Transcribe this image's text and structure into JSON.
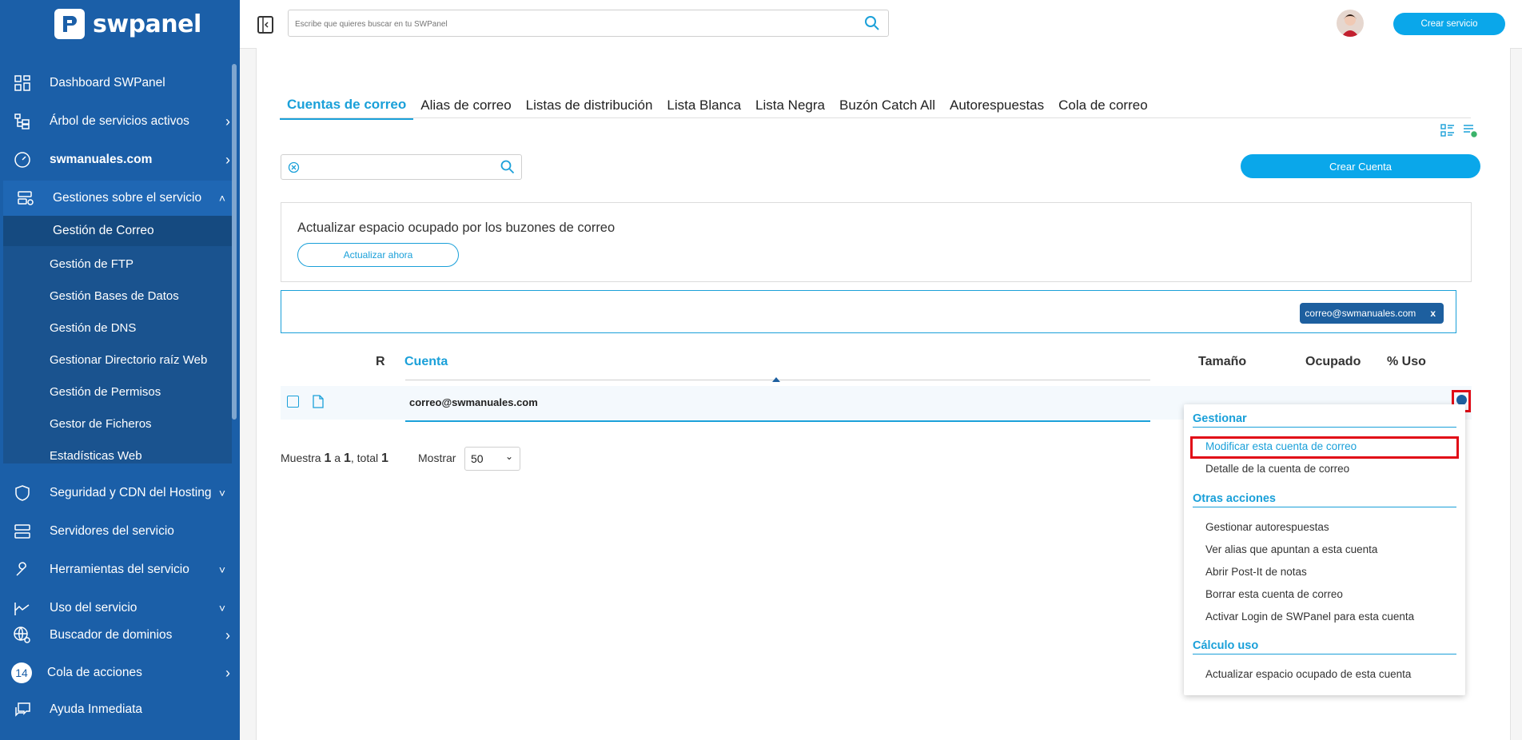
{
  "app": {
    "brand": "swpanel"
  },
  "sidebar": {
    "items": [
      {
        "label": "Dashboard SWPanel",
        "icon": "dashboard-icon"
      },
      {
        "label": "Árbol de servicios activos",
        "icon": "tree-icon"
      },
      {
        "label": "swmanuales.com",
        "icon": "speedometer-icon"
      },
      {
        "label": "Gestiones sobre el servicio",
        "icon": "server-settings-icon"
      },
      {
        "label": "Seguridad y CDN del Hosting",
        "icon": "shield-icon"
      },
      {
        "label": "Servidores del servicio",
        "icon": "servers-icon"
      },
      {
        "label": "Herramientas del servicio",
        "icon": "wrench-icon"
      },
      {
        "label": "Uso del servicio",
        "icon": "chart-icon"
      },
      {
        "label": "Buscador de dominios",
        "icon": "globe-search-icon"
      },
      {
        "label": "Cola de acciones",
        "badge": "14"
      },
      {
        "label": "Ayuda Inmediata",
        "icon": "chat-icon"
      }
    ],
    "subitems": [
      "Gestión de Correo",
      "Gestión de FTP",
      "Gestión Bases de Datos",
      "Gestión de DNS",
      "Gestionar Directorio raíz Web",
      "Gestión de Permisos",
      "Gestor de Ficheros",
      "Estadísticas Web"
    ]
  },
  "topbar": {
    "search_placeholder": "Escribe que quieres buscar en tu SWPanel",
    "create_service": "Crear servicio"
  },
  "tabs": [
    "Cuentas de correo",
    "Alias de correo",
    "Listas de distribución",
    "Lista Blanca",
    "Lista Negra",
    "Buzón Catch All",
    "Autorespuestas",
    "Cola de correo"
  ],
  "main": {
    "create_account": "Crear Cuenta",
    "update_text": "Actualizar espacio ocupado por los buzones de correo",
    "update_button": "Actualizar ahora",
    "filter_chip": "correo@swmanuales.com",
    "filter_chip_close": "x"
  },
  "table": {
    "headers": {
      "r": "R",
      "cuenta": "Cuenta",
      "tamano": "Tamaño",
      "ocupado": "Ocupado",
      "uso": "% Uso"
    },
    "rows": [
      {
        "cuenta": "correo@swmanuales.com"
      }
    ]
  },
  "footer": {
    "muestra_prefix": "Muestra",
    "from": "1",
    "a": "a",
    "to": "1",
    "total_label": ", total",
    "total": "1",
    "mostrar_label": "Mostrar",
    "per_page": "50"
  },
  "dropdown": {
    "gestionar_head": "Gestionar",
    "gestionar_items": [
      "Modificar esta cuenta de correo",
      "Detalle de la cuenta de correo"
    ],
    "otras_head": "Otras acciones",
    "otras_items": [
      "Gestionar autorespuestas",
      "Ver alias que apuntan a esta cuenta",
      "Abrir Post-It de notas",
      "Borrar esta cuenta de correo",
      "Activar Login de SWPanel para esta cuenta"
    ],
    "calculo_head": "Cálculo uso",
    "calculo_items": [
      "Actualizar espacio ocupado de esta cuenta"
    ]
  },
  "colors": {
    "sidebar": "#1b5fa8",
    "accent": "#0aa7ea",
    "highlight": "#e10b17"
  }
}
